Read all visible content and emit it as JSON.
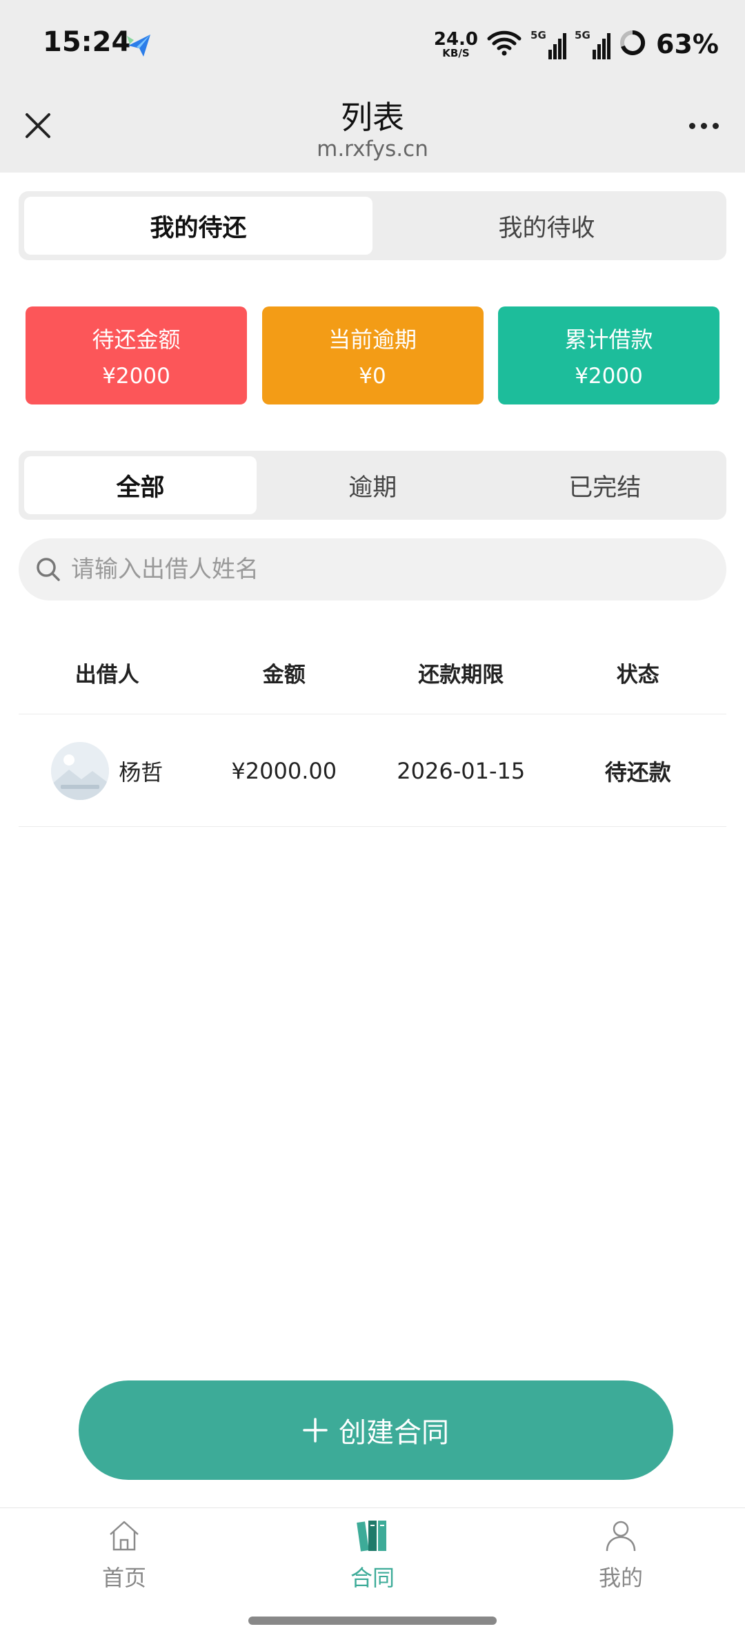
{
  "status_bar": {
    "time": "15:24",
    "net_speed_value": "24.0",
    "net_speed_unit": "KB/S",
    "signal1_label": "5G",
    "signal2_label": "5G",
    "battery": "63%"
  },
  "header": {
    "title": "列表",
    "subtitle": "m.rxfys.cn"
  },
  "top_tabs": {
    "items": [
      {
        "label": "我的待还"
      },
      {
        "label": "我的待收"
      }
    ],
    "active": 0
  },
  "stats": {
    "cards": [
      {
        "label": "待还金额",
        "value": "¥2000",
        "color": "#fc5659"
      },
      {
        "label": "当前逾期",
        "value": "¥0",
        "color": "#f39c16"
      },
      {
        "label": "累计借款",
        "value": "¥2000",
        "color": "#1dbd9b"
      }
    ]
  },
  "filter_tabs": {
    "items": [
      {
        "label": "全部"
      },
      {
        "label": "逾期"
      },
      {
        "label": "已完结"
      }
    ],
    "active": 0
  },
  "search": {
    "placeholder": "请输入出借人姓名",
    "value": ""
  },
  "table": {
    "headers": [
      "出借人",
      "金额",
      "还款期限",
      "状态"
    ],
    "rows": [
      {
        "lender": "杨哲",
        "amount": "¥2000.00",
        "deadline": "2026-01-15",
        "status": "待还款"
      }
    ]
  },
  "create_button": {
    "label": "创建合同"
  },
  "bottom_nav": {
    "items": [
      {
        "label": "首页",
        "icon": "home-icon"
      },
      {
        "label": "合同",
        "icon": "contract-books-icon"
      },
      {
        "label": "我的",
        "icon": "user-icon"
      }
    ],
    "active": 1
  },
  "colors": {
    "accent": "#3dab98",
    "status_link": "#3b8ed8"
  }
}
